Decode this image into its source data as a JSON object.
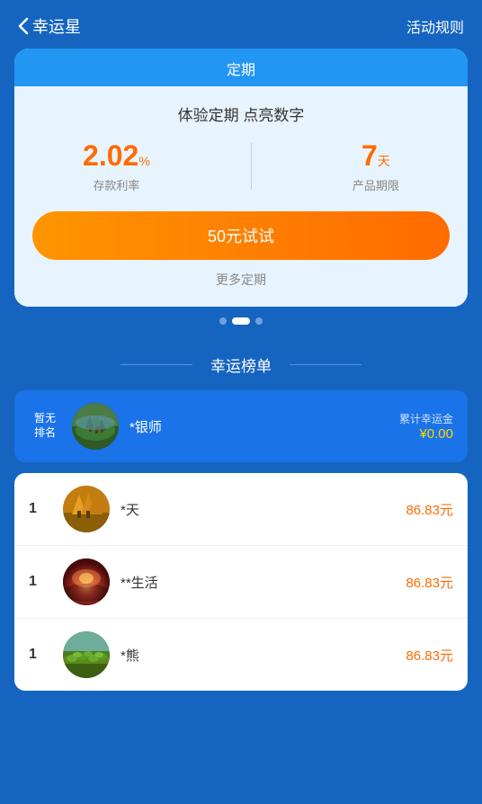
{
  "header": {
    "back_label": "幸运星",
    "rule_label": "活动规则"
  },
  "product": {
    "tab_label": "定期",
    "subtitle": "体验定期 点亮数字",
    "rate": "2.02",
    "rate_unit": "%",
    "rate_label": "存款利率",
    "days": "7",
    "days_unit": "天",
    "days_label": "产品期限",
    "button_label": "50元试试",
    "more_link": "更多定期"
  },
  "lucky_list": {
    "title": "幸运榜单",
    "current_user": {
      "rank": "暂无\n排名",
      "name": "*银师",
      "score_label": "累计幸运金",
      "score": "¥0.00"
    },
    "items": [
      {
        "rank": "1",
        "name": "*天",
        "score": "86.83元",
        "avatar_type": "tree"
      },
      {
        "rank": "1",
        "name": "**生活",
        "score": "86.83元",
        "avatar_type": "sunset"
      },
      {
        "rank": "1",
        "name": "*熊",
        "score": "86.83元",
        "avatar_type": "garden"
      }
    ]
  },
  "dots": [
    {
      "active": false
    },
    {
      "active": true
    },
    {
      "active": false
    }
  ]
}
